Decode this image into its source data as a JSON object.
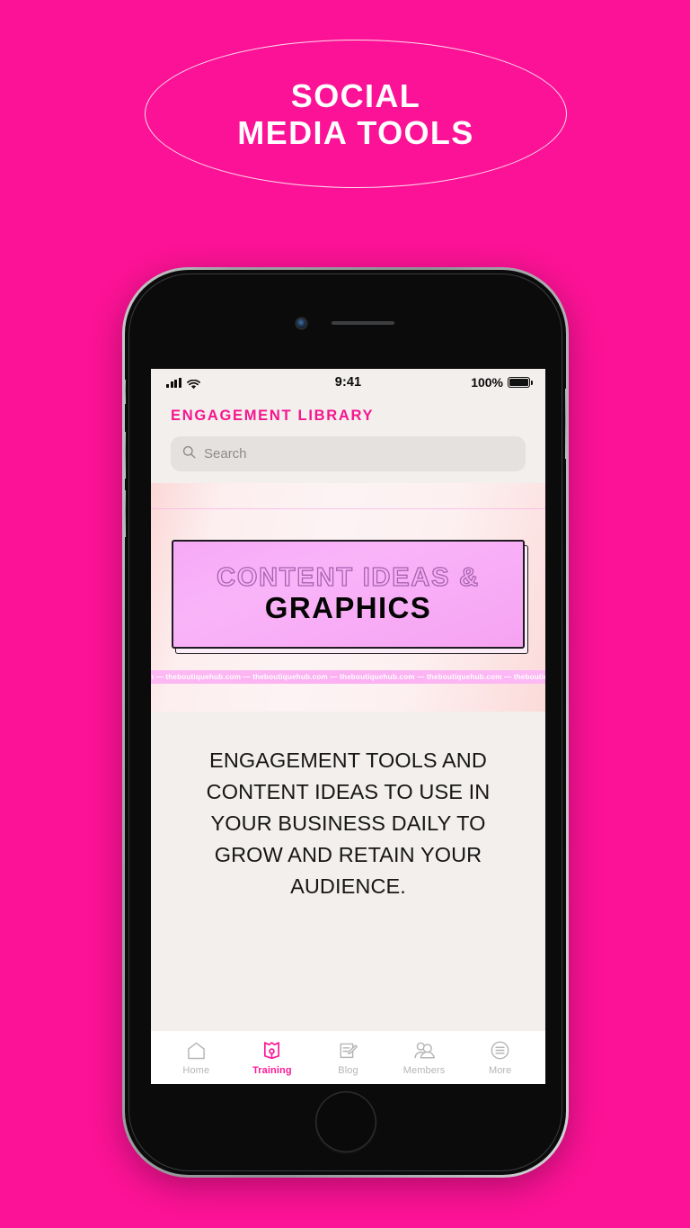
{
  "poster": {
    "background_color": "#fc1296",
    "headline_lines": [
      "SOCIAL",
      "MEDIA TOOLS"
    ]
  },
  "phone": {
    "status_bar": {
      "signal_icon": "signal-bars-icon",
      "wifi_icon": "wifi-icon",
      "time": "9:41",
      "battery_percent": "100%",
      "battery_icon": "battery-full-icon"
    },
    "home_button": "home-button"
  },
  "app": {
    "title": "ENGAGEMENT LIBRARY",
    "accent_color": "#f7158f",
    "search": {
      "icon": "search-icon",
      "placeholder": "Search",
      "value": ""
    },
    "banner": {
      "line1": "CONTENT IDEAS &",
      "line2": "GRAPHICS",
      "card_color": "#f7a9f5",
      "marquee_text": "hub.com  —  theboutiquehub.com — theboutiquehub.com — theboutiquehub.com  —  theboutiquehub.com — theboutiquehub.com"
    },
    "description": "ENGAGEMENT TOOLS AND CONTENT IDEAS TO USE IN YOUR BUSINESS DAILY TO GROW AND RETAIN YOUR AUDIENCE.",
    "tabs": [
      {
        "label": "Home",
        "icon": "home-icon",
        "active": false
      },
      {
        "label": "Training",
        "icon": "book-icon",
        "active": true
      },
      {
        "label": "Blog",
        "icon": "document-pencil-icon",
        "active": false
      },
      {
        "label": "Members",
        "icon": "people-icon",
        "active": false
      },
      {
        "label": "More",
        "icon": "menu-circle-icon",
        "active": false
      }
    ]
  }
}
